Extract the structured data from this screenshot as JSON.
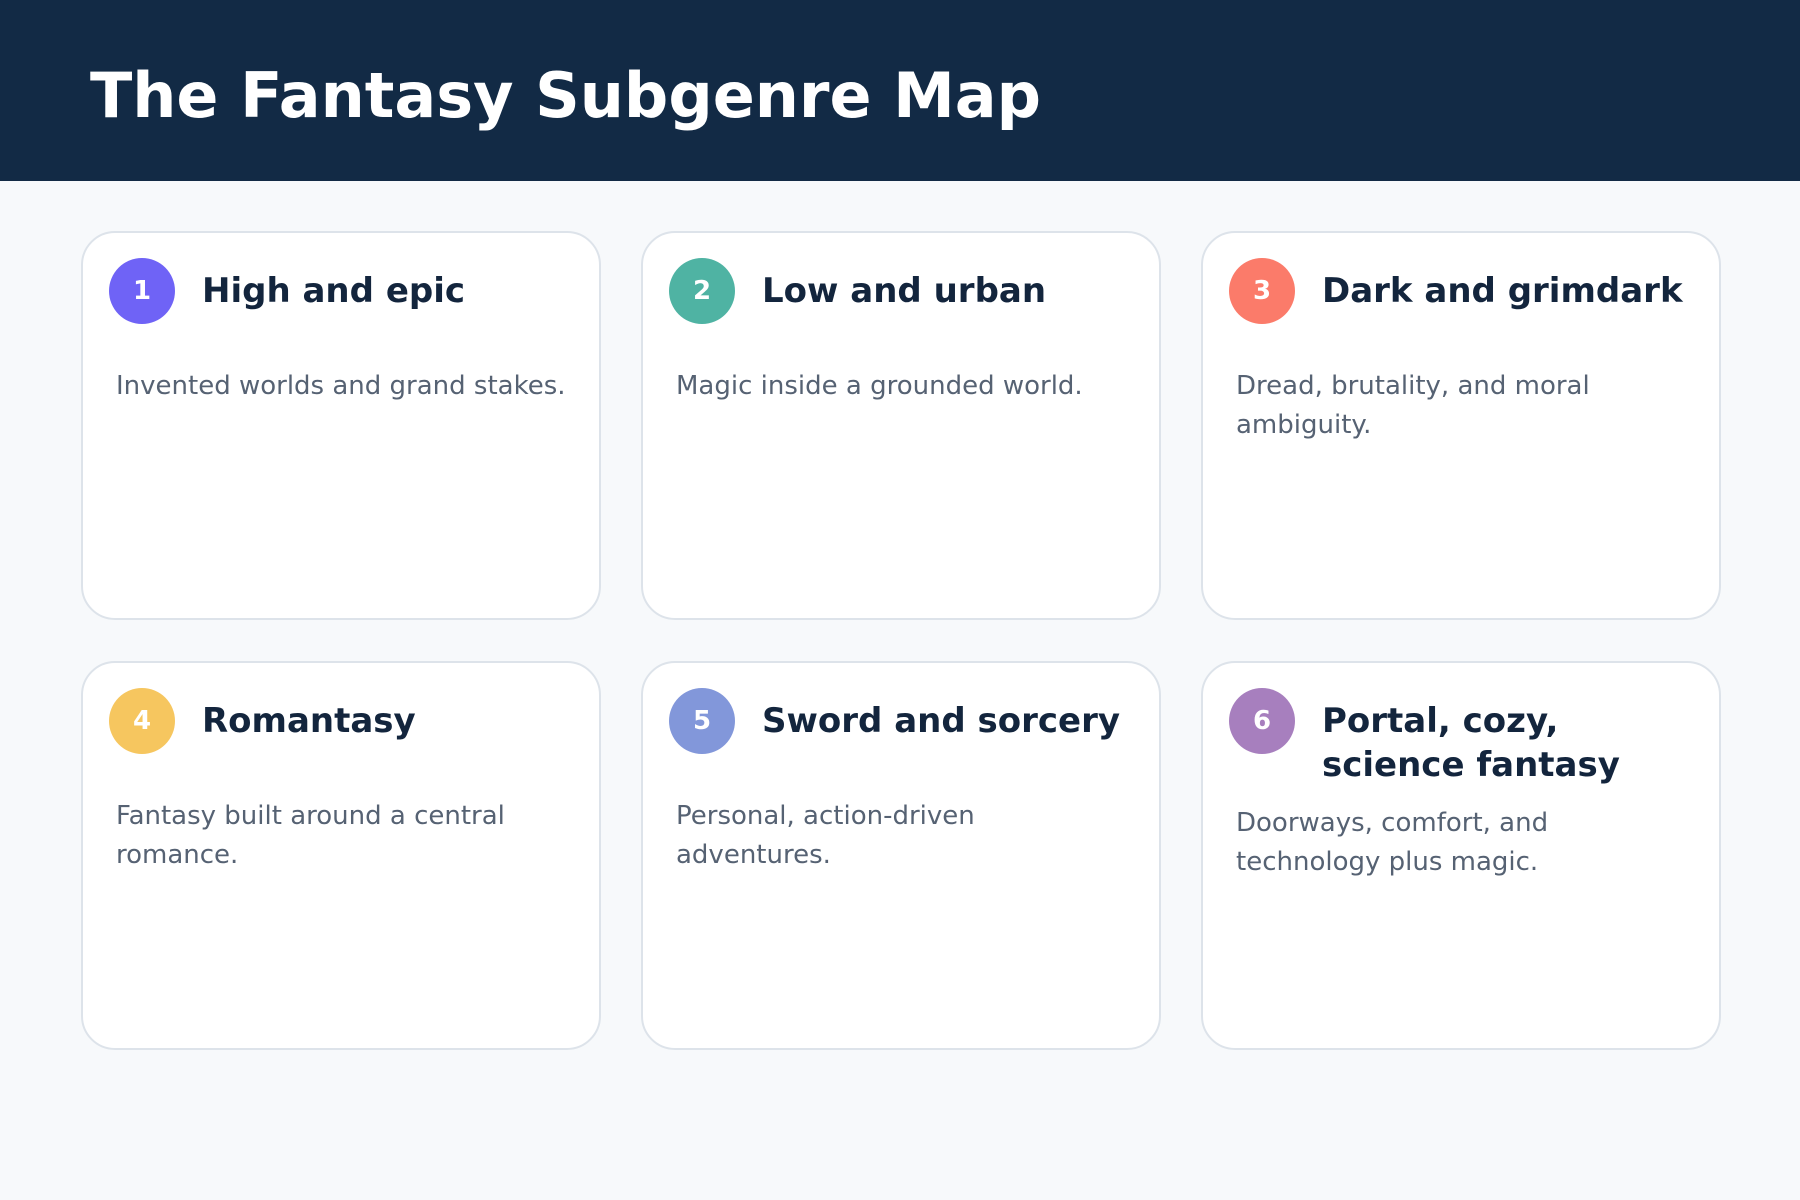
{
  "header": {
    "title": "The Fantasy Subgenre Map"
  },
  "cards": [
    {
      "number": "1",
      "title": "High and epic",
      "description": "Invented worlds and grand stakes.",
      "color": "#6f63f6"
    },
    {
      "number": "2",
      "title": "Low and urban",
      "description": "Magic inside a grounded world.",
      "color": "#4fb3a3"
    },
    {
      "number": "3",
      "title": "Dark and grimdark",
      "description": "Dread, brutality, and moral ambiguity.",
      "color": "#fb7b6a"
    },
    {
      "number": "4",
      "title": "Romantasy",
      "description": "Fantasy built around a central romance.",
      "color": "#f6c65f"
    },
    {
      "number": "5",
      "title": "Sword and sorcery",
      "description": "Personal, action-driven adventures.",
      "color": "#8297da"
    },
    {
      "number": "6",
      "title": "Portal, cozy, science fantasy",
      "description": "Doorways, comfort, and technology plus magic.",
      "color": "#a77fbe"
    }
  ]
}
